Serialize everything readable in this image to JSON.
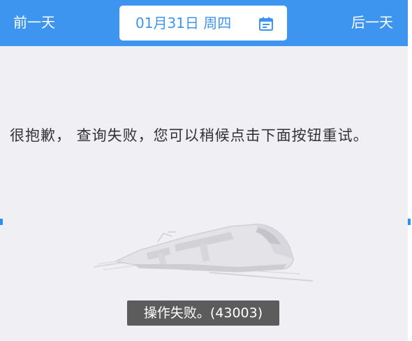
{
  "header": {
    "prev_day_label": "前一天",
    "next_day_label": "后一天",
    "date_label": "01月31日 周四",
    "calendar_icon": "calendar-icon"
  },
  "message": {
    "text": "很抱歉， 查询失败，您可以稍候点击下面按钮重试。"
  },
  "illustration": {
    "icon": "train-icon"
  },
  "toast": {
    "text": "操作失败。(43003)"
  },
  "colors": {
    "header_bg": "#3d95f0",
    "page_bg": "#efeff4",
    "accent_text": "#3d95f0",
    "toast_bg": "#3c3c3c"
  }
}
